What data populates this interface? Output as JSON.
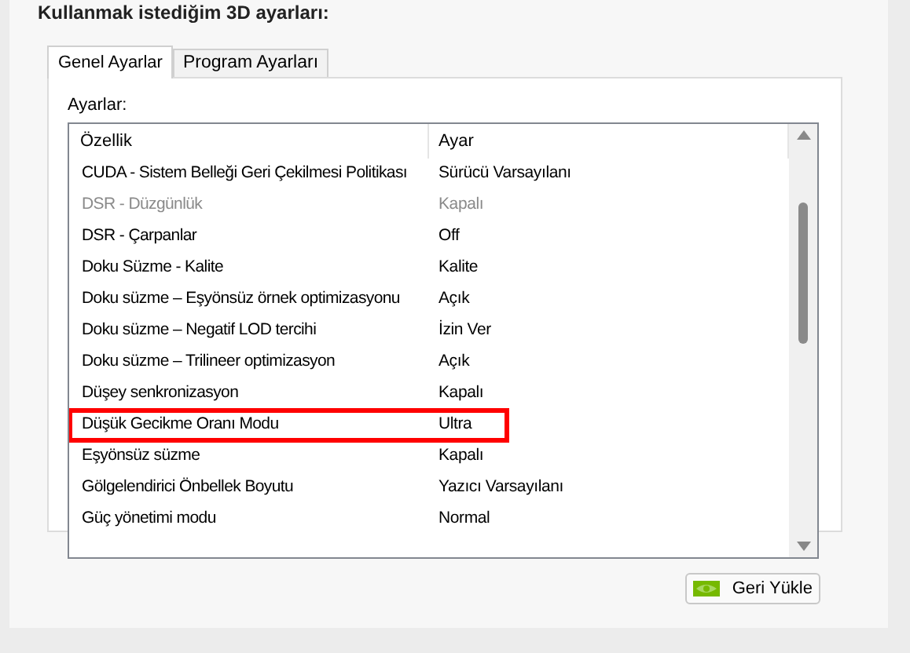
{
  "heading": "Kullanmak istediğim 3D ayarları:",
  "tabs": [
    {
      "label": "Genel Ayarlar",
      "selected": true
    },
    {
      "label": "Program Ayarları",
      "selected": false
    }
  ],
  "settings_label": "Ayarlar:",
  "table": {
    "columns": [
      "Özellik",
      "Ayar"
    ],
    "rows": [
      {
        "feature": "CUDA - Sistem Belleği Geri Çekilmesi Politikası",
        "value": "Sürücü Varsayılanı",
        "disabled": false,
        "highlighted": false
      },
      {
        "feature": "DSR - Düzgünlük",
        "value": "Kapalı",
        "disabled": true,
        "highlighted": false
      },
      {
        "feature": "DSR - Çarpanlar",
        "value": "Off",
        "disabled": false,
        "highlighted": false
      },
      {
        "feature": "Doku Süzme - Kalite",
        "value": "Kalite",
        "disabled": false,
        "highlighted": false
      },
      {
        "feature": "Doku süzme – Eşyönsüz örnek optimizasyonu",
        "value": "Açık",
        "disabled": false,
        "highlighted": false
      },
      {
        "feature": "Doku süzme – Negatif LOD tercihi",
        "value": "İzin Ver",
        "disabled": false,
        "highlighted": false
      },
      {
        "feature": "Doku süzme – Trilineer optimizasyon",
        "value": "Açık",
        "disabled": false,
        "highlighted": false
      },
      {
        "feature": "Düşey senkronizasyon",
        "value": "Kapalı",
        "disabled": false,
        "highlighted": false
      },
      {
        "feature": "Düşük Gecikme Oranı Modu",
        "value": "Ultra",
        "disabled": false,
        "highlighted": true
      },
      {
        "feature": "Eşyönsüz süzme",
        "value": "Kapalı",
        "disabled": false,
        "highlighted": false
      },
      {
        "feature": "Gölgelendirici Önbellek Boyutu",
        "value": "Yazıcı Varsayılanı",
        "disabled": false,
        "highlighted": false
      },
      {
        "feature": "Güç yönetimi modu",
        "value": "Normal",
        "disabled": false,
        "highlighted": false
      }
    ]
  },
  "restore_button": "Geri Yükle"
}
